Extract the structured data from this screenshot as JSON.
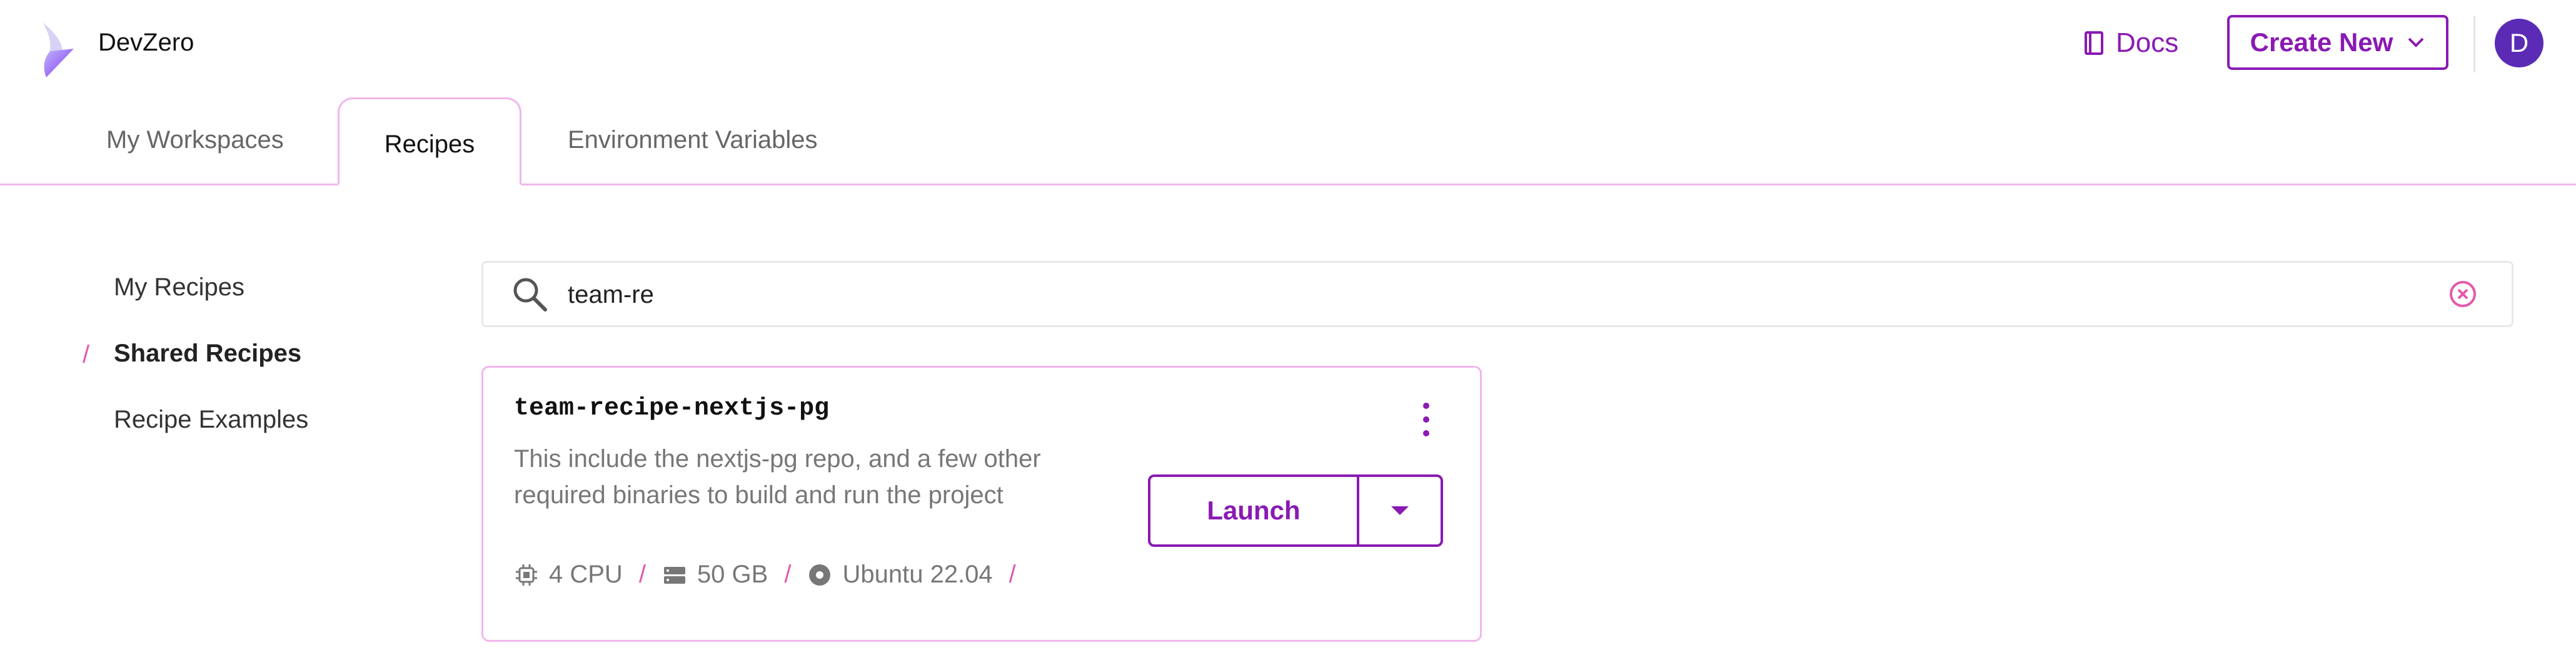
{
  "header": {
    "brand": "DevZero",
    "docs_label": "Docs",
    "create_label": "Create New",
    "avatar_initial": "D"
  },
  "tabs": [
    {
      "label": "My Workspaces",
      "active": false
    },
    {
      "label": "Recipes",
      "active": true
    },
    {
      "label": "Environment Variables",
      "active": false
    }
  ],
  "sidebar": {
    "items": [
      {
        "label": "My Recipes"
      },
      {
        "label": "Shared Recipes",
        "active": true
      },
      {
        "label": "Recipe Examples"
      }
    ],
    "active_marker": "/"
  },
  "search": {
    "value": "team-re"
  },
  "card": {
    "title": "team-recipe-nextjs-pg",
    "description": "This include the nextjs-pg repo, and a few other required binaries to build and run the project",
    "launch_label": "Launch",
    "specs": {
      "cpu": "4 CPU",
      "storage": "50 GB",
      "os": "Ubuntu 22.04",
      "separator": "/"
    }
  },
  "colors": {
    "accent": "#8a1ab3",
    "tab_border": "#f0b7ec",
    "separator": "#e35aa9",
    "avatar_bg": "#5b2bb5"
  },
  "icons": [
    "devzero-logo",
    "book-icon",
    "chevron-down-icon",
    "search-icon",
    "clear-icon",
    "kebab-menu-icon",
    "caret-down-icon",
    "cpu-icon",
    "storage-icon",
    "disk-icon"
  ]
}
